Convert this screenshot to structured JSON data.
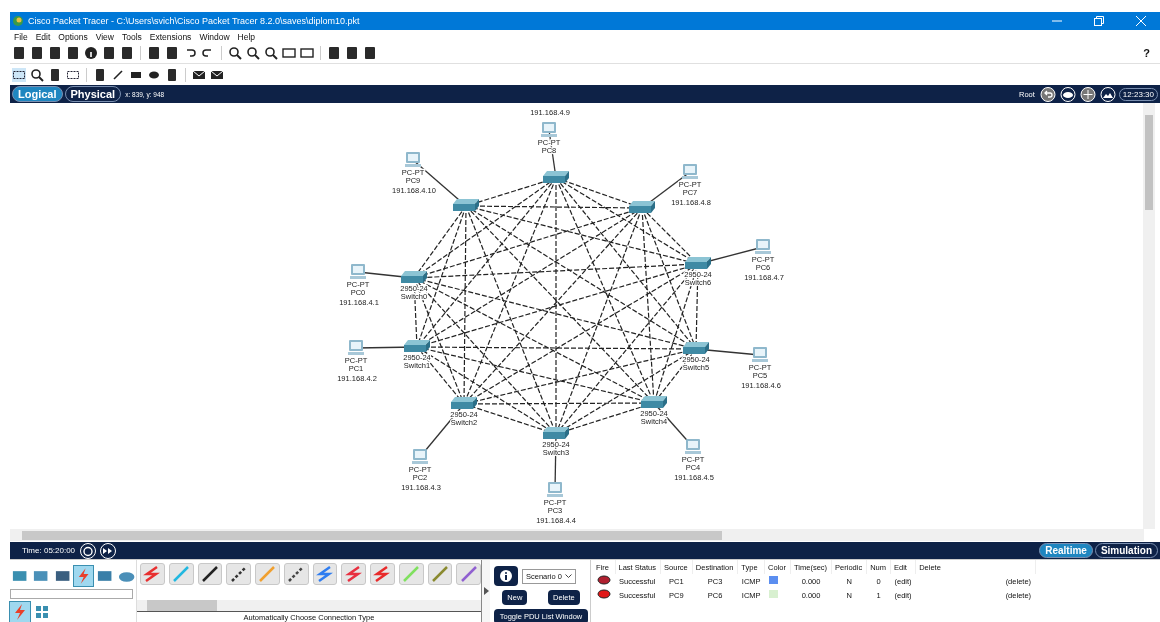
{
  "window": {
    "title": "Cisco Packet Tracer - C:\\Users\\svich\\Cisco Packet Tracer 8.2.0\\saves\\diplom10.pkt"
  },
  "menu": [
    "File",
    "Edit",
    "Options",
    "View",
    "Tools",
    "Extensions",
    "Window",
    "Help"
  ],
  "help": "?",
  "workspace_bar": {
    "tabs": [
      {
        "label": "Logical",
        "selected": true
      },
      {
        "label": "Physical",
        "selected": false
      }
    ],
    "coords": "x: 839, y: 948",
    "root": "Root",
    "clock": "12:23:30"
  },
  "network": {
    "switches": [
      {
        "kind": "switch"
      },
      {
        "kind": "switch"
      },
      {
        "kind": "switch"
      },
      {
        "kind": "switch",
        "model": "2950-24",
        "name": "Switch6"
      },
      {
        "kind": "switch",
        "model": "2950-24",
        "name": "Switch0"
      },
      {
        "kind": "switch",
        "model": "2950-24",
        "name": "Switch1"
      },
      {
        "kind": "switch",
        "model": "2950-24",
        "name": "Switch5"
      },
      {
        "kind": "switch",
        "model": "2950-24",
        "name": "Switch2"
      },
      {
        "kind": "switch",
        "model": "2950-24",
        "name": "Switch4"
      },
      {
        "kind": "switch",
        "model": "2950-24",
        "name": "Switch3"
      }
    ],
    "pcs": [
      {
        "type": "PC-PT",
        "name": "PC8",
        "ip": "191.168.4.9"
      },
      {
        "type": "PC-PT",
        "name": "PC9",
        "ip": "191.168.4.10"
      },
      {
        "type": "PC-PT",
        "name": "PC7",
        "ip": "191.168.4.8"
      },
      {
        "type": "PC-PT",
        "name": "PC6",
        "ip": "191.168.4.7"
      },
      {
        "type": "PC-PT",
        "name": "PC0",
        "ip": "191.168.4.1"
      },
      {
        "type": "PC-PT",
        "name": "PC1",
        "ip": "191.168.4.2"
      },
      {
        "type": "PC-PT",
        "name": "PC5",
        "ip": "191.168.4.6"
      },
      {
        "type": "PC-PT",
        "name": "PC4",
        "ip": "191.168.4.5"
      },
      {
        "type": "PC-PT",
        "name": "PC2",
        "ip": "191.168.4.3"
      },
      {
        "type": "PC-PT",
        "name": "PC3",
        "ip": "191.168.4.4"
      }
    ]
  },
  "time_bar": {
    "time": "Time: 05:20:00",
    "modes": [
      {
        "label": "Realtime",
        "selected": true
      },
      {
        "label": "Simulation",
        "selected": false
      }
    ]
  },
  "device_categories": [
    {
      "kind": "network",
      "selected": false
    },
    {
      "kind": "end",
      "selected": false
    },
    {
      "kind": "component",
      "selected": false
    },
    {
      "kind": "connection",
      "selected": true
    },
    {
      "kind": "misc",
      "selected": false
    },
    {
      "kind": "cloud",
      "selected": false
    }
  ],
  "subcategories": [
    {
      "kind": "connection",
      "selected": true
    },
    {
      "kind": "grid",
      "selected": false
    }
  ],
  "connection_types": [
    {
      "color": "#e83030"
    },
    {
      "color": "#22b8e0"
    },
    {
      "color": "#222222"
    },
    {
      "color": "#333333"
    },
    {
      "color": "#f0a030"
    },
    {
      "color": "#444444"
    },
    {
      "color": "#2f7df0"
    },
    {
      "color": "#e83040"
    },
    {
      "color": "#e82a2a"
    },
    {
      "color": "#80e060"
    },
    {
      "color": "#8a8a30"
    },
    {
      "color": "#9060d0"
    }
  ],
  "connection_hint": "Automatically Choose Connection Type",
  "scenario": {
    "value": "Scenario 0",
    "buttons": [
      "New",
      "Delete"
    ],
    "toggle": "Toggle PDU List Window"
  },
  "pdu_table": {
    "columns": [
      "Fire",
      "Last Status",
      "Source",
      "Destination",
      "Type",
      "Color",
      "Time(sec)",
      "Periodic",
      "Num",
      "Edit",
      "Delete"
    ],
    "rows": [
      {
        "last_status": "Successful",
        "source": "PC1",
        "destination": "PC3",
        "type": "ICMP",
        "color": "#5b8ef0",
        "time": "0.000",
        "periodic": "N",
        "num": "0",
        "edit": "(edit)",
        "delete": "(delete)"
      },
      {
        "last_status": "Successful",
        "source": "PC9",
        "destination": "PC6",
        "type": "ICMP",
        "color": "#d8f0d0",
        "time": "0.000",
        "periodic": "N",
        "num": "1",
        "edit": "(edit)",
        "delete": "(delete)"
      }
    ]
  }
}
